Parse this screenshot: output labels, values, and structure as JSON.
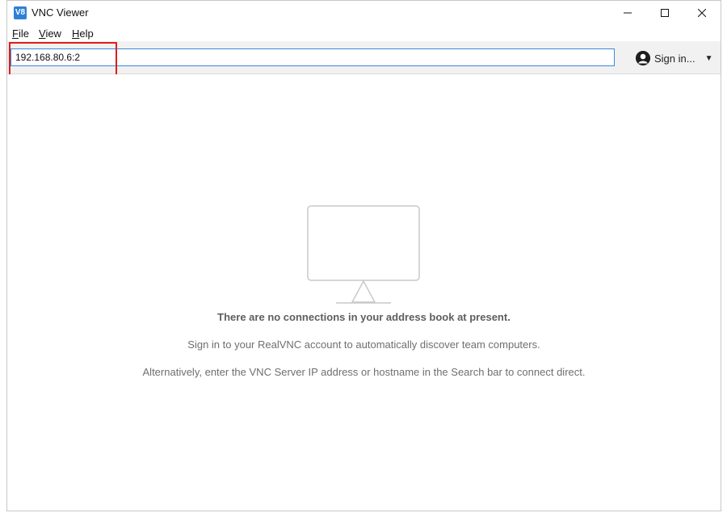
{
  "window": {
    "title": "VNC Viewer",
    "icon_label": "V8"
  },
  "menu": {
    "items": [
      {
        "label": "File",
        "accel": "F",
        "rest": "ile"
      },
      {
        "label": "View",
        "accel": "V",
        "rest": "iew"
      },
      {
        "label": "Help",
        "accel": "H",
        "rest": "elp"
      }
    ]
  },
  "toolbar": {
    "search_value": "192.168.80.6:2",
    "signin_label": "Sign in...",
    "highlight_color": "#e11d1d"
  },
  "empty_state": {
    "title": "There are no connections in your address book at present.",
    "line1": "Sign in to your RealVNC account to automatically discover team computers.",
    "line2": "Alternatively, enter the VNC Server IP address or hostname in the Search bar to connect direct."
  },
  "colors": {
    "accent": "#3a8ad6",
    "icon_bg": "#2f7fd8"
  },
  "icons": [
    "app-icon",
    "minimize-icon",
    "maximize-icon",
    "close-icon",
    "user-avatar-icon",
    "chevron-down-icon",
    "monitor-icon"
  ]
}
